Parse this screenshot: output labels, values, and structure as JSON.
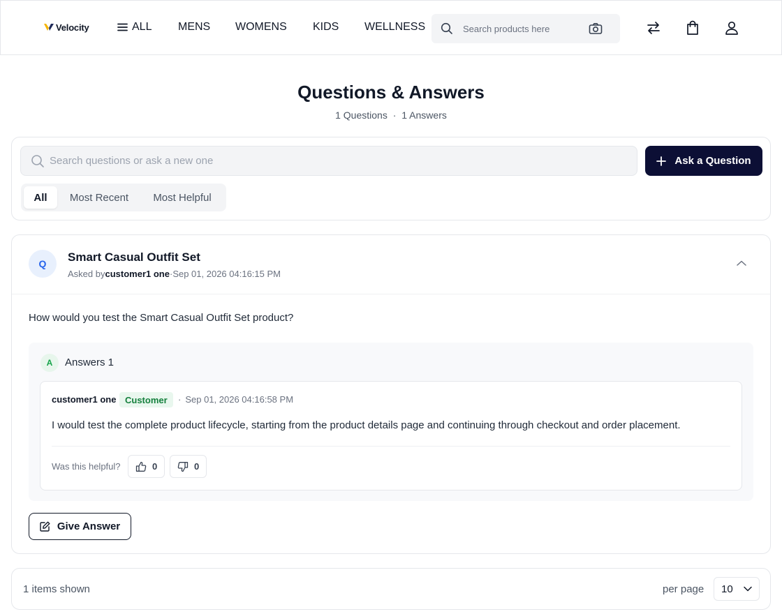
{
  "header": {
    "logo_text": "Velocity",
    "nav": [
      {
        "label": "ALL"
      },
      {
        "label": "MENS"
      },
      {
        "label": "WOMENS"
      },
      {
        "label": "KIDS"
      },
      {
        "label": "WELLNESS"
      }
    ],
    "search_placeholder": "Search products here",
    "icons": [
      "search-icon",
      "camera-icon",
      "compare-icon",
      "shopping-bag-icon",
      "user-icon"
    ]
  },
  "page": {
    "title": "Questions & Answers",
    "questions_count": "1 Questions",
    "separator": "·",
    "answers_count": "1 Answers"
  },
  "filter": {
    "search_placeholder": "Search questions or ask a new one",
    "ask_button": "Ask a Question",
    "tabs": [
      {
        "label": "All",
        "active": true
      },
      {
        "label": "Most Recent",
        "active": false
      },
      {
        "label": "Most Helpful",
        "active": false
      }
    ]
  },
  "question": {
    "badge": "Q",
    "title": "Smart Casual Outfit Set",
    "asked_by_label": "Asked by",
    "author": "customer1 one",
    "meta_separator": "·",
    "date": "Sep 01, 2026 04:16:15 PM",
    "text": "How would you test the Smart Casual Outfit Set product?",
    "answers": {
      "badge": "A",
      "label": "Answers 1",
      "items": [
        {
          "author": "customer1 one",
          "role": "Customer",
          "separator": "·",
          "date": "Sep 01, 2026 04:16:58 PM",
          "text": "I would test the complete product lifecycle, starting from the product details page and continuing through checkout and order placement.",
          "helpful_label": "Was this helpful?",
          "upvotes": "0",
          "downvotes": "0"
        }
      ]
    },
    "give_answer_button": "Give Answer"
  },
  "footer": {
    "items_shown": "1 items shown",
    "per_page_label": "per page",
    "per_page_value": "10"
  },
  "colors": {
    "primary_button": "#0c0f35",
    "question_badge_bg": "#e8f0fd",
    "question_badge_text": "#2563eb",
    "answer_badge_text": "#16a34a",
    "customer_tag_bg": "#e9f7ee",
    "customer_tag_text": "#15803d",
    "logo_accent": "#f5b400"
  }
}
